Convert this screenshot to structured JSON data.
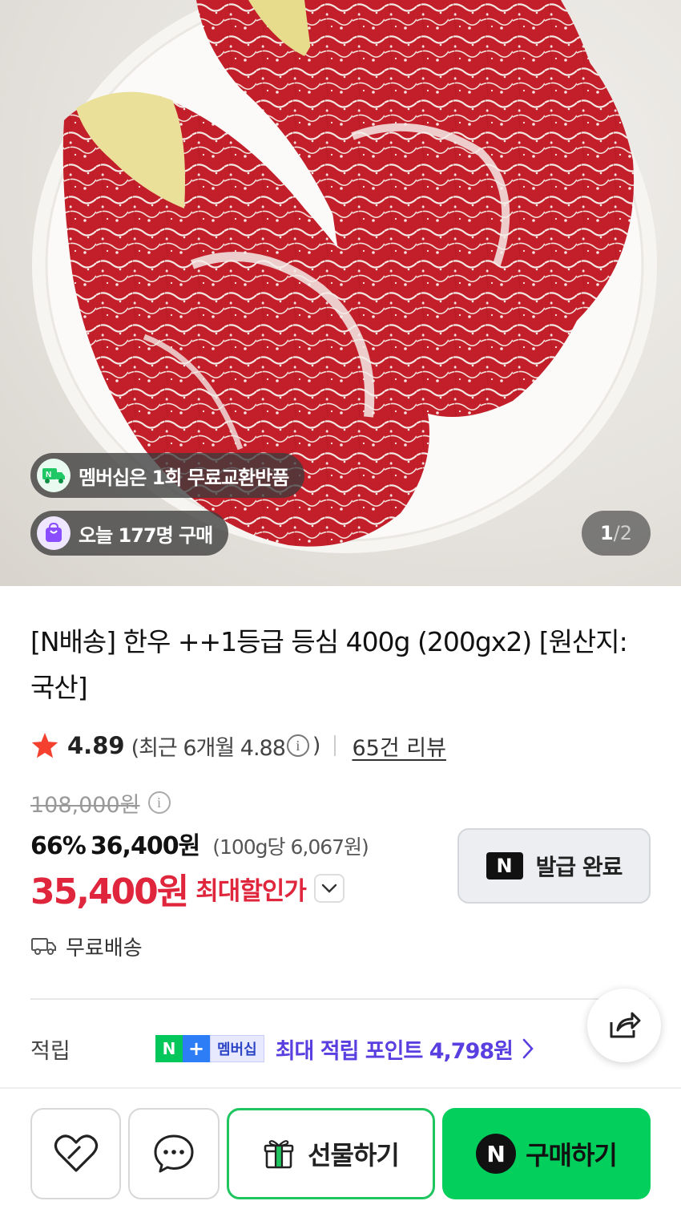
{
  "hero": {
    "badge_membership": "멤버십은 1회 무료교환반품",
    "badge_today": "오늘 177명 구매",
    "page_current": "1",
    "page_separator": "/",
    "page_total": "2"
  },
  "product": {
    "title": "[N배송] 한우 ++1등급 등심 400g (200gx2) [원산지:국산]",
    "rating": "4.89",
    "recent_rating": "(최근 6개월 4.88",
    "recent_close": ")",
    "info_symbol": "i",
    "reviews": "65건 리뷰"
  },
  "price": {
    "original": "108,000원",
    "discount_pct": "66%",
    "sale": "36,400원",
    "per_unit": "(100g당 6,067원)",
    "max_discount": "35,400원",
    "max_label": "최대할인가"
  },
  "coupon": {
    "logo": "N",
    "label": "발급 완료"
  },
  "shipping": {
    "label": "무료배송"
  },
  "points": {
    "label": "적립",
    "badge_n": "N",
    "badge_plus": "+",
    "badge_membership": "멤버십",
    "text": "최대 적립 포인트 4,798원"
  },
  "actions": {
    "gift": "선물하기",
    "buy_logo": "N",
    "buy": "구매하기"
  },
  "colors": {
    "accent_red": "#e0263c",
    "naver_green": "#03cf5d",
    "point_purple": "#5a3fe0"
  },
  "icons": [
    "star-icon",
    "info-icon",
    "chevron-down-icon",
    "truck-icon",
    "share-icon",
    "chevron-right-icon",
    "heart-icon",
    "chat-icon",
    "gift-icon",
    "naver-n-icon"
  ]
}
